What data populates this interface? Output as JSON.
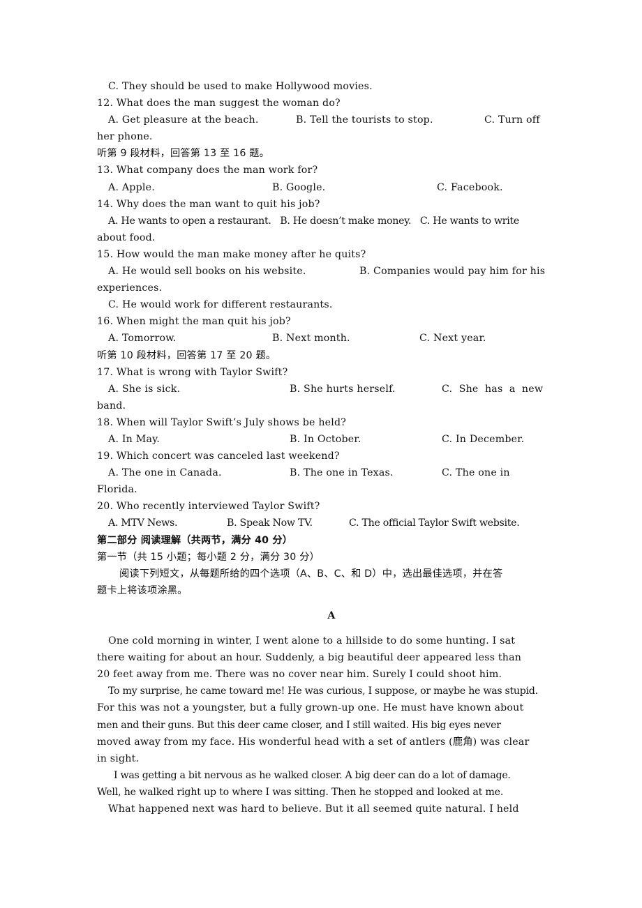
{
  "listening": {
    "q11_option_c": "C. They should be used to make Hollywood movies.",
    "q12": {
      "question": "12. What does the man suggest the woman do?",
      "a": "A. Get pleasure at the beach.",
      "b": "B. Tell the tourists to stop.",
      "c": "C. Turn off",
      "c_cont": "her phone."
    },
    "section9_instruction": "听第 9 段材料，回答第 13 至 16 题。",
    "q13": {
      "question": "13. What company does the man work for?",
      "a": "A. Apple.",
      "b": "B. Google.",
      "c": "C. Facebook."
    },
    "q14": {
      "question": "14. Why does the man want to quit his job?",
      "line": "A. He wants to open a restaurant.   B. He doesn’t make money.   C. He wants to write",
      "c_cont": "about food."
    },
    "q15": {
      "question": "15. How would the man make money after he quits?",
      "a": "A. He would sell books on his website.",
      "b": "B. Companies would pay him for his",
      "b_cont": "experiences.",
      "c": "C. He would work for different restaurants."
    },
    "q16": {
      "question": "16. When might the man quit his job?",
      "a": "A. Tomorrow.",
      "b": "B. Next month.",
      "c": "C. Next year."
    },
    "section10_instruction": "听第 10 段材料，回答第 17 至 20 题。",
    "q17": {
      "question": "17. What is wrong with Taylor Swift?",
      "a": "A. She is sick.",
      "b": "B. She hurts herself.",
      "c": "C.  She  has  a  new",
      "c_cont": "band."
    },
    "q18": {
      "question": "18. When will Taylor Swift’s July shows be held?",
      "a": "A. In May.",
      "b": "B. In October.",
      "c": "C. In December."
    },
    "q19": {
      "question": "19. Which concert was canceled last weekend?",
      "a": "A. The one in Canada.",
      "b": "B. The one in Texas.",
      "c": "C. The one in",
      "c_cont": "Florida."
    },
    "q20": {
      "question": "20. Who recently interviewed Taylor Swift?",
      "a": "A. MTV News.",
      "b": "B. Speak Now TV.",
      "c": "C. The official Taylor Swift website."
    }
  },
  "reading": {
    "part_title": "第二部分 阅读理解（共两节，满分 40 分）",
    "section_title": "第一节（共 15 小题；每小题 2 分，满分 30 分）",
    "instruction_line1": "阅读下列短文，从每题所给的四个选项（A、B、C、和 D）中，选出最佳选项，并在答",
    "instruction_line2": "题卡上将该项涂黑。",
    "passage_label": "A",
    "passage_lines": [
      "One cold morning in winter, I went alone to a hillside to do some hunting. I sat",
      "there waiting for about an hour. Suddenly, a big beautiful deer appeared less than",
      "20 feet away from me. There was no cover near him. Surely I could shoot him.",
      "To my surprise, he came toward me! He was curious, I suppose, or maybe he was stupid.",
      "For this was not a youngster, but a fully grown-up one. He must have known about",
      "men and their guns. But this deer came closer, and I still waited. His big eyes never",
      "moved away from my face. His wonderful head with a set of antlers (鹿角) was clear",
      "in sight.",
      "I was getting a bit nervous as he walked closer. A big deer can do a lot of damage.",
      "Well, he walked right up to where I was sitting. Then he stopped and looked at me.",
      "What happened next was hard to believe. But it all seemed quite natural. I held"
    ]
  }
}
